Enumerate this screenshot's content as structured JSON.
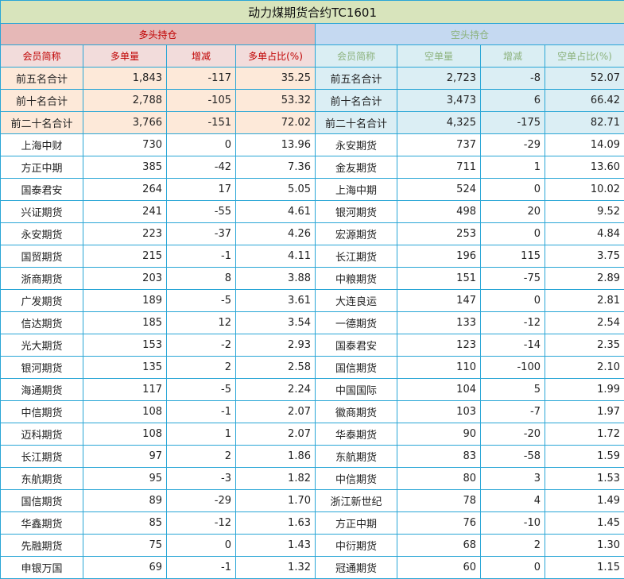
{
  "title": "动力煤期货合约TC1601",
  "groups": {
    "long": "多头持仓",
    "short": "空头持仓"
  },
  "headers": {
    "long": [
      "会员简称",
      "多单量",
      "增减",
      "多单占比(%)"
    ],
    "short": [
      "会员简称",
      "空单量",
      "增减",
      "空单占比(%)"
    ]
  },
  "summary_rows": [
    {
      "long": [
        "前五名合计",
        "1,843",
        "-117",
        "35.25"
      ],
      "short": [
        "前五名合计",
        "2,723",
        "-8",
        "52.07"
      ]
    },
    {
      "long": [
        "前十名合计",
        "2,788",
        "-105",
        "53.32"
      ],
      "short": [
        "前十名合计",
        "3,473",
        "6",
        "66.42"
      ]
    },
    {
      "long": [
        "前二十名合计",
        "3,766",
        "-151",
        "72.02"
      ],
      "short": [
        "前二十名合计",
        "4,325",
        "-175",
        "82.71"
      ]
    }
  ],
  "rows": [
    {
      "long": [
        "上海中财",
        "730",
        "0",
        "13.96"
      ],
      "short": [
        "永安期货",
        "737",
        "-29",
        "14.09"
      ]
    },
    {
      "long": [
        "方正中期",
        "385",
        "-42",
        "7.36"
      ],
      "short": [
        "金友期货",
        "711",
        "1",
        "13.60"
      ]
    },
    {
      "long": [
        "国泰君安",
        "264",
        "17",
        "5.05"
      ],
      "short": [
        "上海中期",
        "524",
        "0",
        "10.02"
      ]
    },
    {
      "long": [
        "兴证期货",
        "241",
        "-55",
        "4.61"
      ],
      "short": [
        "银河期货",
        "498",
        "20",
        "9.52"
      ]
    },
    {
      "long": [
        "永安期货",
        "223",
        "-37",
        "4.26"
      ],
      "short": [
        "宏源期货",
        "253",
        "0",
        "4.84"
      ]
    },
    {
      "long": [
        "国贸期货",
        "215",
        "-1",
        "4.11"
      ],
      "short": [
        "长江期货",
        "196",
        "115",
        "3.75"
      ]
    },
    {
      "long": [
        "浙商期货",
        "203",
        "8",
        "3.88"
      ],
      "short": [
        "中粮期货",
        "151",
        "-75",
        "2.89"
      ]
    },
    {
      "long": [
        "广发期货",
        "189",
        "-5",
        "3.61"
      ],
      "short": [
        "大连良运",
        "147",
        "0",
        "2.81"
      ]
    },
    {
      "long": [
        "信达期货",
        "185",
        "12",
        "3.54"
      ],
      "short": [
        "一德期货",
        "133",
        "-12",
        "2.54"
      ]
    },
    {
      "long": [
        "光大期货",
        "153",
        "-2",
        "2.93"
      ],
      "short": [
        "国泰君安",
        "123",
        "-14",
        "2.35"
      ]
    },
    {
      "long": [
        "银河期货",
        "135",
        "2",
        "2.58"
      ],
      "short": [
        "国信期货",
        "110",
        "-100",
        "2.10"
      ]
    },
    {
      "long": [
        "海通期货",
        "117",
        "-5",
        "2.24"
      ],
      "short": [
        "中国国际",
        "104",
        "5",
        "1.99"
      ]
    },
    {
      "long": [
        "中信期货",
        "108",
        "-1",
        "2.07"
      ],
      "short": [
        "徽商期货",
        "103",
        "-7",
        "1.97"
      ]
    },
    {
      "long": [
        "迈科期货",
        "108",
        "1",
        "2.07"
      ],
      "short": [
        "华泰期货",
        "90",
        "-20",
        "1.72"
      ]
    },
    {
      "long": [
        "长江期货",
        "97",
        "2",
        "1.86"
      ],
      "short": [
        "东航期货",
        "83",
        "-58",
        "1.59"
      ]
    },
    {
      "long": [
        "东航期货",
        "95",
        "-3",
        "1.82"
      ],
      "short": [
        "中信期货",
        "80",
        "3",
        "1.53"
      ]
    },
    {
      "long": [
        "国信期货",
        "89",
        "-29",
        "1.70"
      ],
      "short": [
        "浙江新世纪",
        "78",
        "4",
        "1.49"
      ]
    },
    {
      "long": [
        "华鑫期货",
        "85",
        "-12",
        "1.63"
      ],
      "short": [
        "方正中期",
        "76",
        "-10",
        "1.45"
      ]
    },
    {
      "long": [
        "先融期货",
        "75",
        "0",
        "1.43"
      ],
      "short": [
        "中衍期货",
        "68",
        "2",
        "1.30"
      ]
    },
    {
      "long": [
        "申银万国",
        "69",
        "-1",
        "1.32"
      ],
      "short": [
        "冠通期货",
        "60",
        "0",
        "1.15"
      ]
    }
  ]
}
